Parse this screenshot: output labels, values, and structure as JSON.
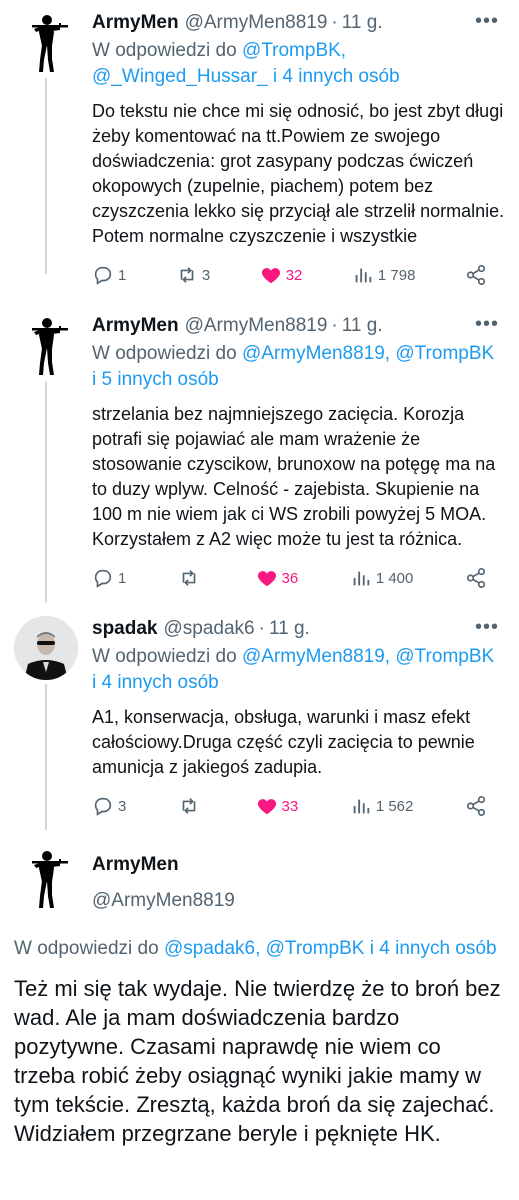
{
  "tweets": [
    {
      "name": "ArmyMen",
      "handle": "@ArmyMen8819",
      "sep": "·",
      "time": "11 g.",
      "reply_prefix": "W odpowiedzi do ",
      "reply_line1_mentions": "@TrompBK,",
      "reply_line2_mentions": "@_Winged_Hussar_",
      "reply_line2_rest": " i 4 innych osób",
      "text": "Do tekstu nie chce mi się odnosić, bo jest zbyt długi żeby komentować na tt.Powiem ze swojego doświadczenia: grot zasypany podczas ćwiczeń okopowych (zupelnie, piachem) potem bez czyszczenia lekko się przyciął ale strzelił normalnie. Potem normalne czyszczenie i wszystkie",
      "replies": "1",
      "retweets": "3",
      "likes": "32",
      "views": "1 798"
    },
    {
      "name": "ArmyMen",
      "handle": "@ArmyMen8819",
      "sep": "·",
      "time": "11 g.",
      "reply_prefix": "W odpowiedzi do ",
      "reply_line1_mentions": "@ArmyMen8819, @TrompBK",
      "reply_line2_mentions": "",
      "reply_line2_rest": "i 5 innych osób",
      "text": "strzelania bez najmniejszego zacięcia. Korozja potrafi się pojawiać ale mam wrażenie że stosowanie czyscikow, brunoxow na potęgę ma na to duzy wplyw. Celność - zajebista. Skupienie na 100 m nie wiem jak ci WS zrobili powyżej 5 MOA. Korzystałem z A2 więc może tu jest ta różnica.",
      "replies": "1",
      "retweets": "",
      "likes": "36",
      "views": "1 400"
    },
    {
      "name": "spadak",
      "handle": "@spadak6",
      "sep": "·",
      "time": "11 g.",
      "reply_prefix": "W odpowiedzi do ",
      "reply_line1_mentions": "@ArmyMen8819, @TrompBK",
      "reply_line2_mentions": "",
      "reply_line2_rest": "i 4 innych osób",
      "text": "A1, konserwacja, obsługa, warunki i masz efekt całościowy.Druga część czyli zacięcia to pewnie amunicja z jakiegoś zadupia.",
      "replies": "3",
      "retweets": "",
      "likes": "33",
      "views": "1 562"
    }
  ],
  "main_tweet": {
    "name": "ArmyMen",
    "handle": "@ArmyMen8819",
    "reply_prefix": "W odpowiedzi do ",
    "reply_mentions": "@spadak6, @TrompBK",
    "reply_rest": " i 4 innych osób",
    "text": "Też mi się tak wydaje. Nie twierdzę że to broń bez wad. Ale ja mam doświadczenia bardzo pozytywne. Czasami naprawdę nie wiem co trzeba robić żeby osiągnąć wyniki jakie mamy w tym tekście. Zresztą, każda broń da się zajechać. Widziałem przegrzane beryle i pęknięte HK."
  },
  "icons": {
    "reply": "reply-icon",
    "retweet": "retweet-icon",
    "like": "heart-icon",
    "views": "views-icon",
    "share": "share-icon",
    "more": "more-icon"
  },
  "colors": {
    "link": "#1d9bf0",
    "like": "#f91880",
    "secondary": "#536471",
    "text": "#0f1419"
  }
}
